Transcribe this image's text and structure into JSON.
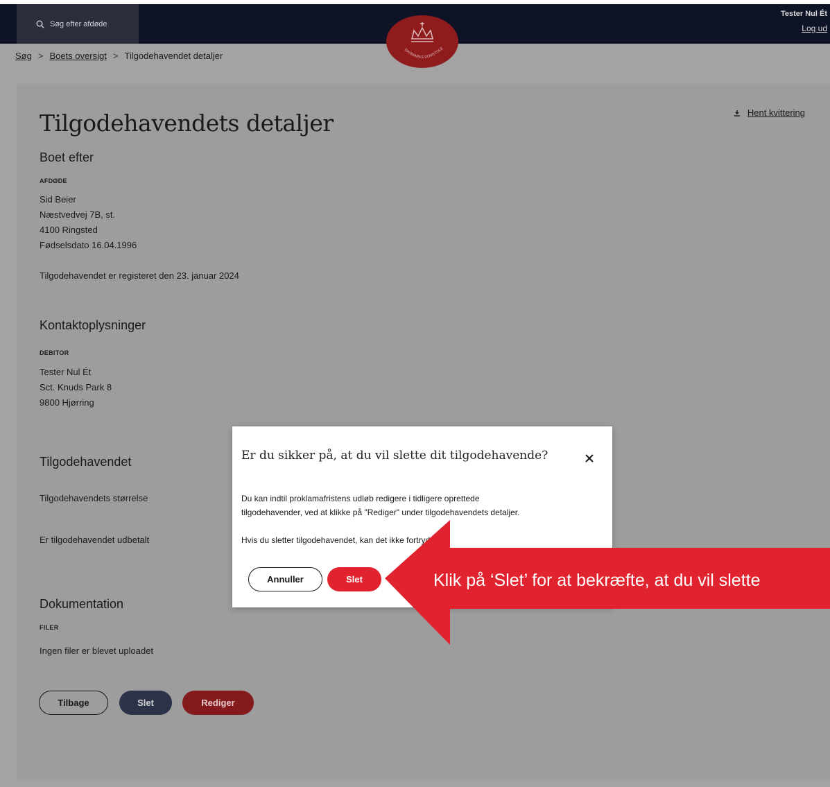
{
  "header": {
    "search_label": "Søg efter afdøde",
    "user_name": "Tester Nul Ét",
    "logout": "Log ud",
    "logo_text": "DANMARKS DOMSTOLE"
  },
  "breadcrumb": {
    "items": [
      "Søg",
      "Boets oversigt",
      "Tilgodehavendet detaljer"
    ],
    "separator": ">"
  },
  "page": {
    "title": "Tilgodehavendets detaljer",
    "receipt_link": "Hent kvittering",
    "estate": {
      "heading": "Boet efter",
      "label": "AFDØDE",
      "name": "Sid Beier",
      "street": "Næstvedvej 7B, st.",
      "city": "4100 Ringsted",
      "birth": "Fødselsdato 16.04.1996",
      "registered": "Tilgodehavendet er registeret den 23. januar 2024"
    },
    "contact": {
      "heading": "Kontaktoplysninger",
      "label": "DEBITOR",
      "name": "Tester Nul Ét",
      "street": "Sct. Knuds Park 8",
      "city": "9800 Hjørring"
    },
    "claim": {
      "heading": "Tilgodehavendet",
      "size_label": "Tilgodehavendets størrelse",
      "paid_label": "Er tilgodehavendet udbetalt"
    },
    "documentation": {
      "heading": "Dokumentation",
      "label": "FILER",
      "empty": "Ingen filer er blevet uploadet"
    },
    "buttons": {
      "back": "Tilbage",
      "delete": "Slet",
      "edit": "Rediger"
    }
  },
  "modal": {
    "title": "Er du sikker på, at du vil slette dit tilgodehavende?",
    "line1": "Du kan indtil proklamafristens udløb redigere i tidligere oprettede",
    "line2": "tilgodehavender, ved at klikke på \"Rediger\" under tilgodehavendets detaljer.",
    "line3": "Hvis du sletter tilgodehavendet, kan det ikke fortrydes.",
    "cancel": "Annuller",
    "confirm": "Slet"
  },
  "callout": {
    "text": "Klik på ‘Slet’ for at bekræfte, at du vil slette",
    "color": "#e1232f"
  }
}
